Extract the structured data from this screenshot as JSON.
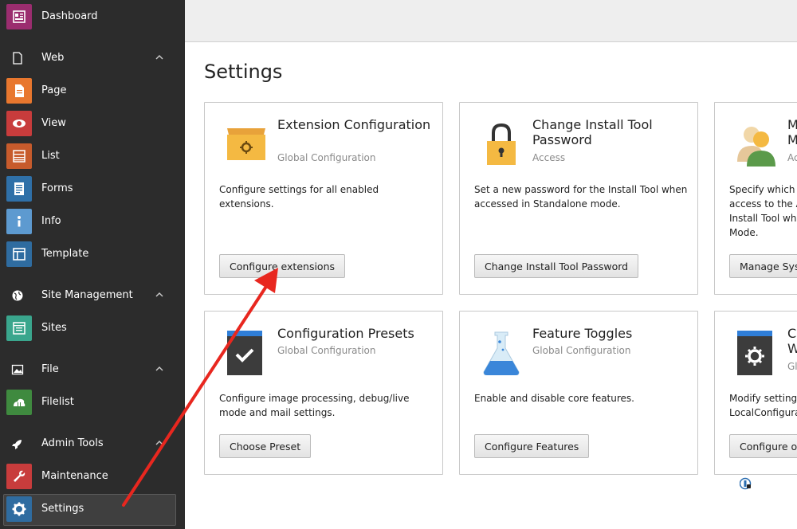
{
  "sidebar": {
    "dashboard": "Dashboard",
    "web_group": "Web",
    "web_items": [
      "Page",
      "View",
      "List",
      "Forms",
      "Info",
      "Template"
    ],
    "site_group": "Site Management",
    "site_items": [
      "Sites"
    ],
    "file_group": "File",
    "file_items": [
      "Filelist"
    ],
    "admin_group": "Admin Tools",
    "admin_items": [
      "Maintenance",
      "Settings"
    ]
  },
  "main": {
    "title": "Settings",
    "cards": [
      {
        "title": "Extension Configuration",
        "subtitle": "Global Configuration",
        "description": "Configure settings for all enabled extensions.",
        "button": "Configure extensions",
        "icon": "box-gear-icon"
      },
      {
        "title": "Change Install Tool Password",
        "subtitle": "Access",
        "description": "Set a new password for the Install Tool when accessed in Standalone mode.",
        "button": "Change Install Tool Password",
        "icon": "padlock-icon"
      },
      {
        "title": "M\nM",
        "subtitle": "Ac",
        "description": "Specify which\naccess to the A\nInstall Tool wh\nMode.",
        "button": "Manage Sys",
        "icon": "users-icon"
      },
      {
        "title": "Configuration Presets",
        "subtitle": "Global Configuration",
        "description": "Configure image processing, debug/live mode and mail settings.",
        "button": "Choose Preset",
        "icon": "checkbox-icon"
      },
      {
        "title": "Feature Toggles",
        "subtitle": "Global Configuration",
        "description": "Enable and disable core features.",
        "button": "Configure Features",
        "icon": "flask-icon"
      },
      {
        "title": "C\nW",
        "subtitle": "Gl",
        "description": "Modify setting\nLocalConfigura",
        "button": "Configure op",
        "icon": "window-gear-icon"
      }
    ]
  },
  "colors": {
    "dashboard": "#9b2d6f",
    "page": "#e8772e",
    "view": "#c83c3c",
    "list": "#c75b2c",
    "forms": "#2f70a8",
    "info": "#5d9ad0",
    "template": "#2f6ca0",
    "sites": "#3aa68d",
    "filelist": "#3f8a3f",
    "maintenance": "#c83c3c",
    "settings": "#2f6ca0"
  }
}
